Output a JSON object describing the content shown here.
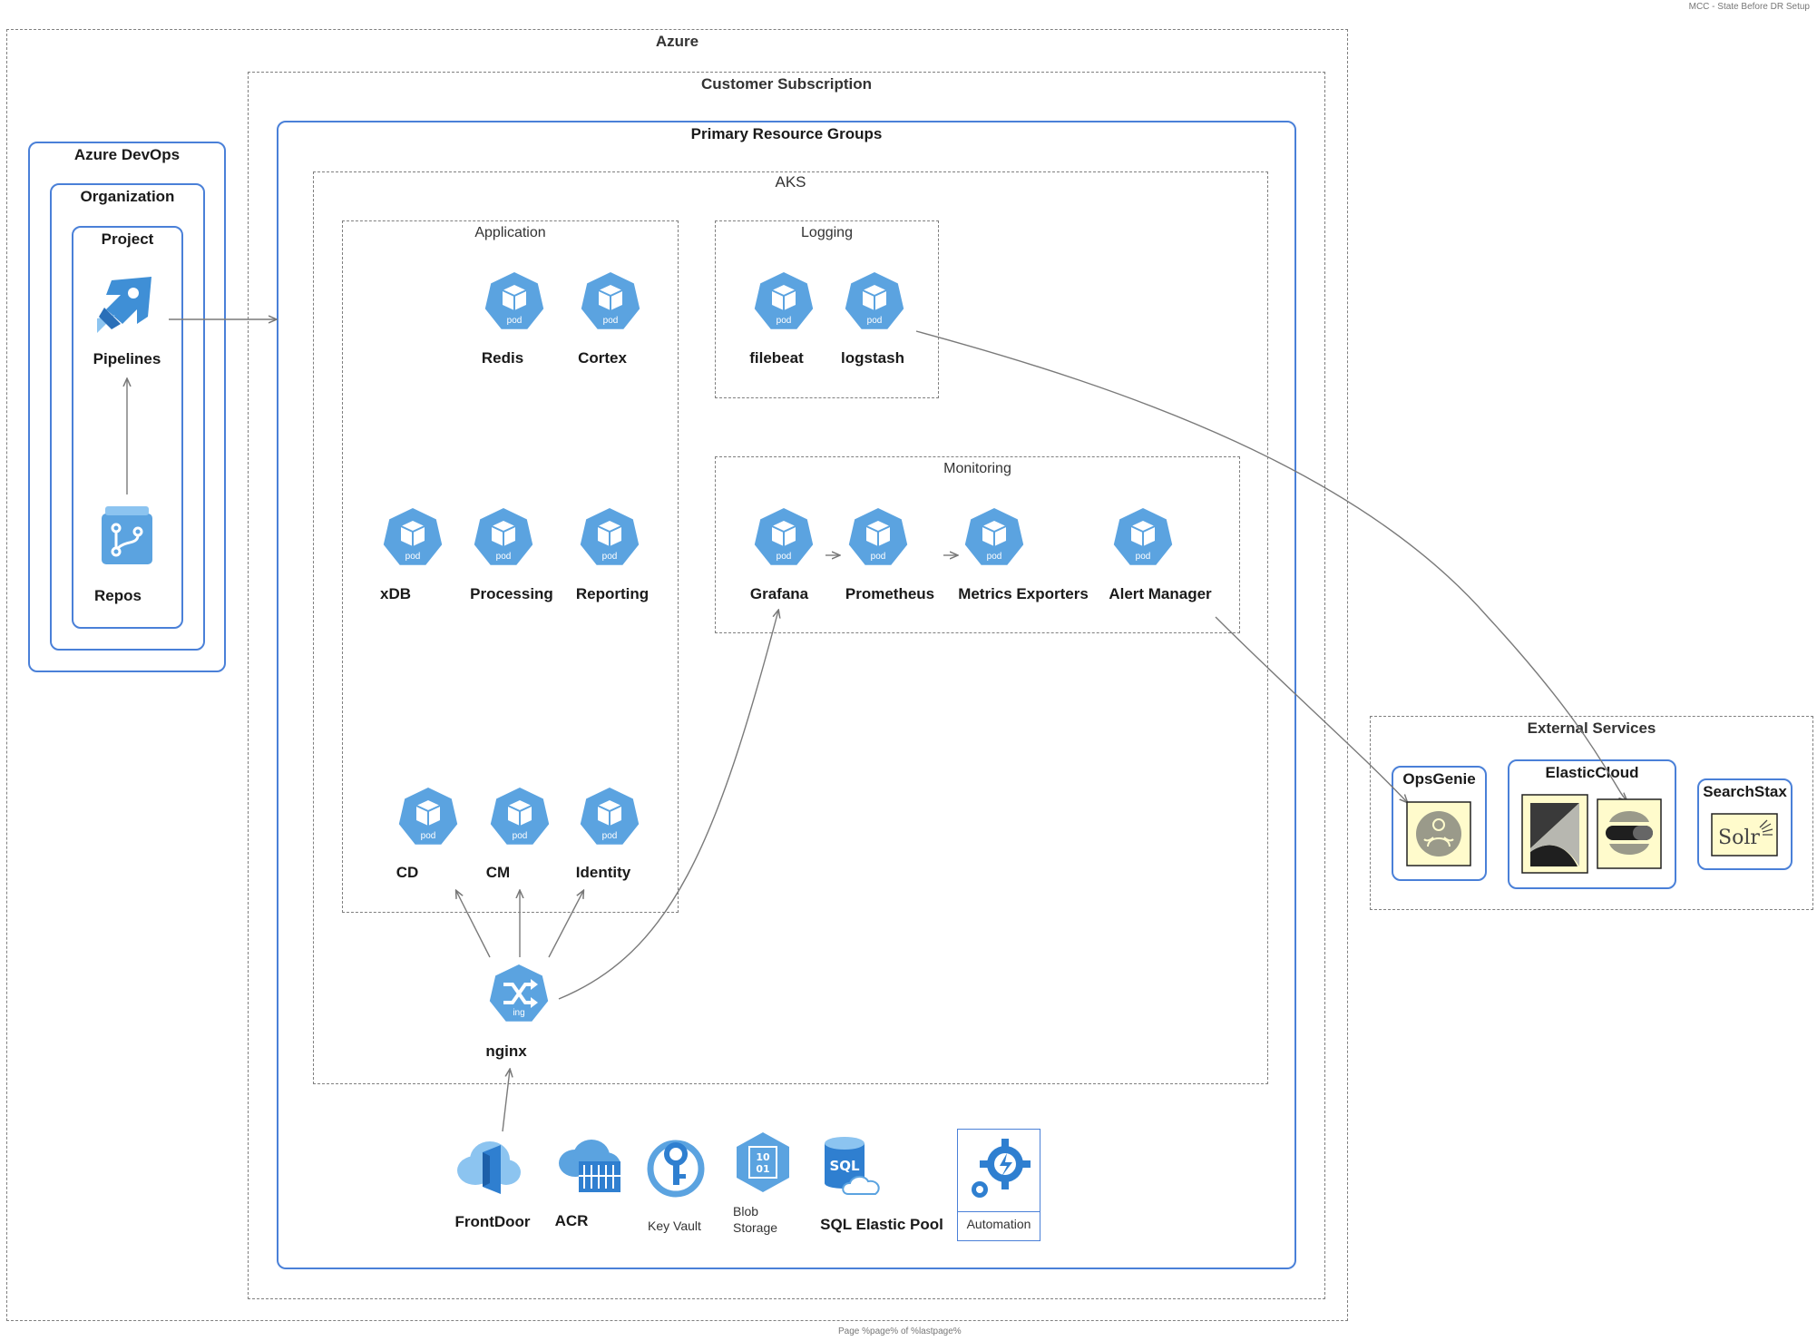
{
  "header": {
    "doc_title": "MCC - State Before DR Setup"
  },
  "footer": {
    "page_text": "Page %page% of %lastpage%"
  },
  "groups": {
    "azure": "Azure",
    "subscription": "Customer Subscription",
    "primary": "Primary Resource Groups",
    "aks": "AKS",
    "application": "Application",
    "logging": "Logging",
    "monitoring": "Monitoring",
    "devops": "Azure DevOps",
    "organization": "Organization",
    "project": "Project",
    "external": "External Services",
    "opsgenie": "OpsGenie",
    "elasticcloud": "ElasticCloud",
    "searchstax": "SearchStax"
  },
  "pod_badge": "pod",
  "ing_badge": "ing",
  "nodes": {
    "pipelines": "Pipelines",
    "repos": "Repos",
    "redis": "Redis",
    "cortex": "Cortex",
    "xdb": "xDB",
    "processing": "Processing",
    "reporting": "Reporting",
    "cd": "CD",
    "cm": "CM",
    "identity": "Identity",
    "nginx": "nginx",
    "filebeat": "filebeat",
    "logstash": "logstash",
    "grafana": "Grafana",
    "prometheus": "Prometheus",
    "metrics_exporters": "Metrics Exporters",
    "alert_manager": "Alert Manager",
    "frontdoor": "FrontDoor",
    "acr": "ACR",
    "key_vault": "Key Vault",
    "blob_line1": "Blob",
    "blob_line2": "Storage",
    "sql_pool": "SQL Elastic Pool",
    "automation": "Automation",
    "sql_glyph": "SQL",
    "blob_glyph_1": "10",
    "blob_glyph_2": "01",
    "solr": "Solr"
  },
  "colors": {
    "accent_blue": "#4a80d8",
    "pod_blue": "#5ba3e0",
    "dash_gray": "#7f7f7f",
    "logo_bg": "#fffbcc"
  }
}
